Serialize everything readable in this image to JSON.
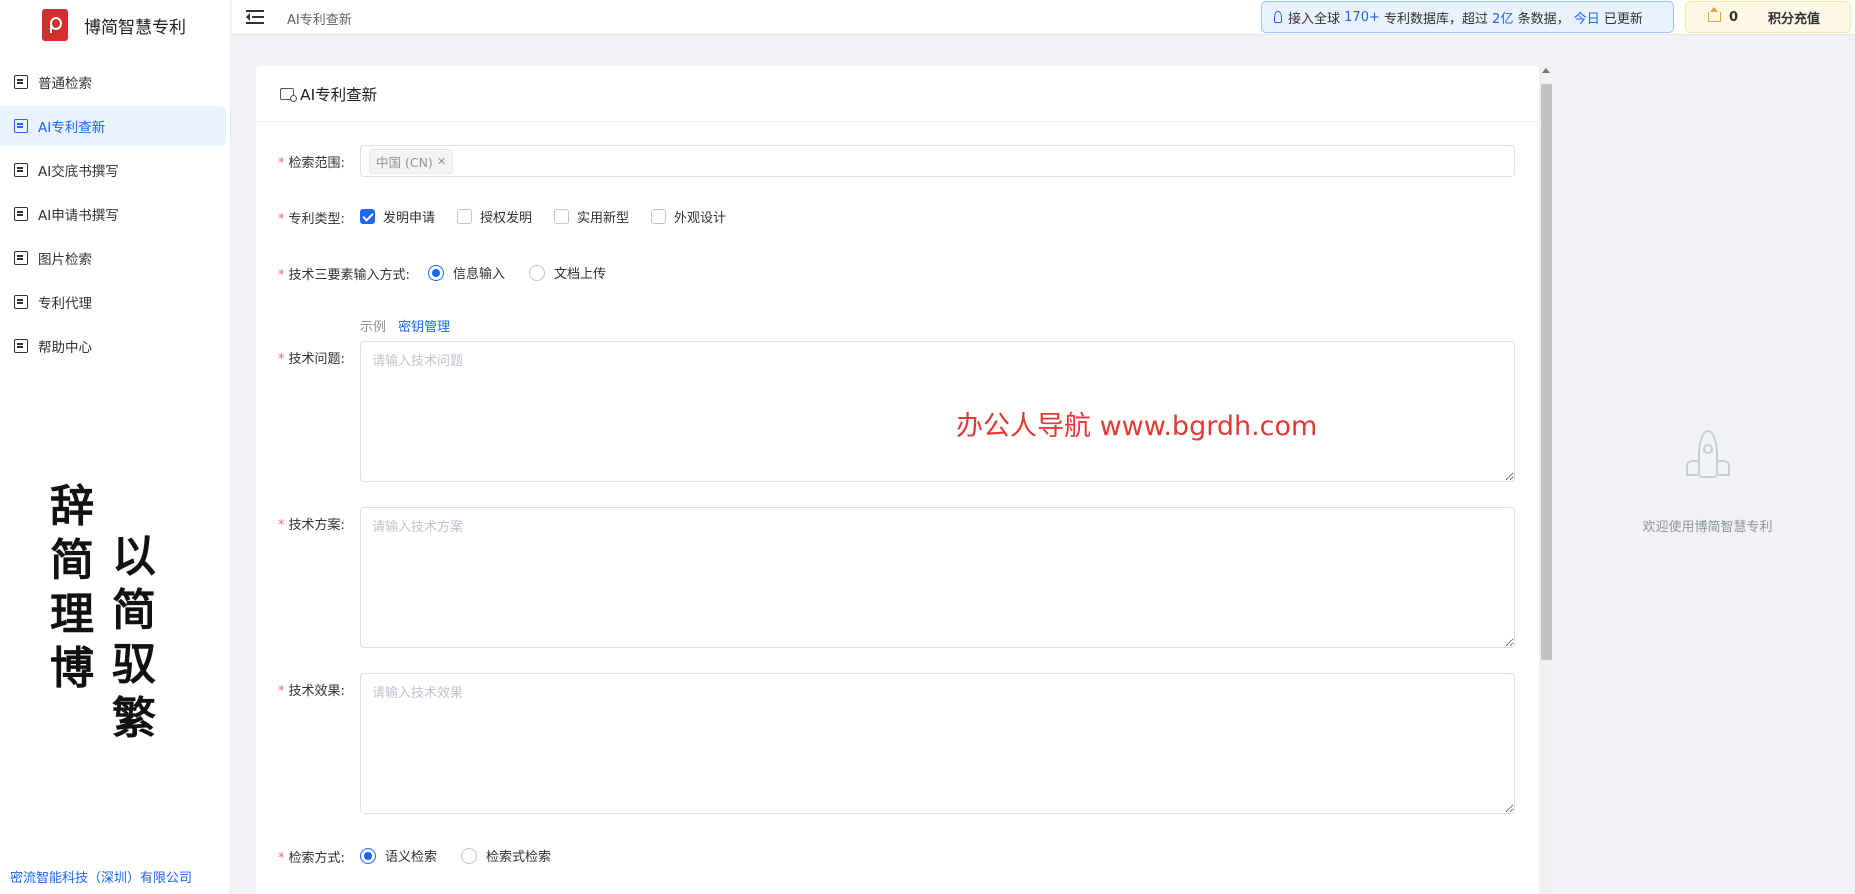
{
  "brand": {
    "name": "博简智慧专利"
  },
  "sidebar": {
    "items": [
      {
        "label": "普通检索",
        "icon": "search-doc-icon",
        "active": false
      },
      {
        "label": "AI专利查新",
        "icon": "ai-search-icon",
        "active": true
      },
      {
        "label": "AI交底书撰写",
        "icon": "doc-icon",
        "active": false
      },
      {
        "label": "AI申请书撰写",
        "icon": "edit-icon",
        "active": false
      },
      {
        "label": "图片检索",
        "icon": "image-icon",
        "active": false
      },
      {
        "label": "专利代理",
        "icon": "agent-doc-icon",
        "active": false
      },
      {
        "label": "帮助中心",
        "icon": "book-icon",
        "active": false
      }
    ],
    "calligraphy": {
      "col1": "辞简理博",
      "col2": "以简驭繁"
    },
    "company": "密流智能科技（深圳）有限公司"
  },
  "topbar": {
    "breadcrumb": "AI专利查新",
    "notice": {
      "p1": "接入全球",
      "n1": "170+",
      "p2": "专利数据库，超过",
      "n2": "2亿",
      "p3": "条数据，",
      "n3": "今日",
      "p4": "已更新"
    },
    "points": {
      "value": "0",
      "recharge": "积分充值"
    }
  },
  "form": {
    "title": "AI专利查新",
    "scope": {
      "label": "检索范围:",
      "tags": [
        "中国 (CN)"
      ]
    },
    "type": {
      "label": "专利类型:",
      "options": [
        {
          "label": "发明申请",
          "checked": true
        },
        {
          "label": "授权发明",
          "checked": false
        },
        {
          "label": "实用新型",
          "checked": false
        },
        {
          "label": "外观设计",
          "checked": false
        }
      ]
    },
    "input_mode": {
      "label": "技术三要素输入方式:",
      "options": [
        {
          "label": "信息输入",
          "selected": true
        },
        {
          "label": "文档上传",
          "selected": false
        }
      ]
    },
    "links": {
      "example": "示例",
      "key": "密钥管理"
    },
    "problem": {
      "label": "技术问题:",
      "placeholder": "请输入技术问题",
      "value": ""
    },
    "solution": {
      "label": "技术方案:",
      "placeholder": "请输入技术方案",
      "value": ""
    },
    "effect": {
      "label": "技术效果:",
      "placeholder": "请输入技术效果",
      "value": ""
    },
    "search_method": {
      "label": "检索方式:",
      "options": [
        {
          "label": "语义检索",
          "selected": true
        },
        {
          "label": "检索式检索",
          "selected": false
        }
      ]
    }
  },
  "watermark": "办公人导航  www.bgrdh.com",
  "empty_panel": {
    "text": "欢迎使用博简智慧专利",
    "icon": "rocket-icon"
  },
  "colors": {
    "accent": "#1a66ff",
    "required": "#f56c6c",
    "watermark": "#e53935",
    "points_bg": "#fff8e6",
    "notice_bg": "#eaf2ff"
  }
}
